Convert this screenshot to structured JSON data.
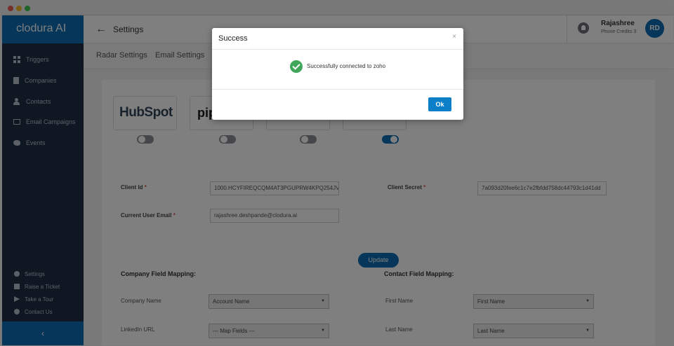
{
  "app": {
    "brand": "clodura AI"
  },
  "sidebar": {
    "items": [
      {
        "label": "Triggers"
      },
      {
        "label": "Companies"
      },
      {
        "label": "Contacts"
      },
      {
        "label": "Email Campaigns"
      },
      {
        "label": "Events"
      }
    ],
    "bottom_items": [
      {
        "label": "Settings"
      },
      {
        "label": "Raise a Ticket"
      },
      {
        "label": "Take a Tour"
      },
      {
        "label": "Contact Us"
      }
    ],
    "collapse_label": "‹"
  },
  "header": {
    "back_label": "←",
    "title": "Settings",
    "user_name": "Rajashree",
    "credits": "Phone Credits  3",
    "avatar_initials": "RD"
  },
  "tabs": [
    {
      "label": "Radar Settings"
    },
    {
      "label": "Email Settings"
    }
  ],
  "integrations": {
    "hubspot_label": "HubSpot",
    "pipedrive_label": "pip",
    "toggles": [
      false,
      false,
      false,
      true
    ]
  },
  "form": {
    "client_id_label": "Client Id",
    "client_id_value": "1000.HCYFIREQCQM4AT3PGUPRW4KPQ254JV",
    "client_secret_label": "Client Secret",
    "client_secret_value": "7a093d20fee6c1c7e2fbfdd758dc44793c1d41dd",
    "email_label": "Current User Email",
    "email_value": "rajashree.deshpande@clodura.ai",
    "required_mark": "*",
    "update_label": "Update"
  },
  "mapping": {
    "company_title": "Company Field Mapping:",
    "contact_title": "Contact Field Mapping:",
    "company_rows": [
      {
        "label": "Company Name",
        "value": "Account Name"
      },
      {
        "label": "LinkedIn URL",
        "value": "--- Map Fields ---"
      }
    ],
    "contact_rows": [
      {
        "label": "First Name",
        "value": "First Name"
      },
      {
        "label": "Last Name",
        "value": "Last Name"
      }
    ]
  },
  "modal": {
    "title": "Success",
    "close_label": "×",
    "message": "Successfully connected to zoho",
    "ok_label": "Ok"
  },
  "colors": {
    "brand_blue": "#0c6db2",
    "sidebar_bg": "#1f2e44",
    "success_green": "#3fa65a"
  }
}
